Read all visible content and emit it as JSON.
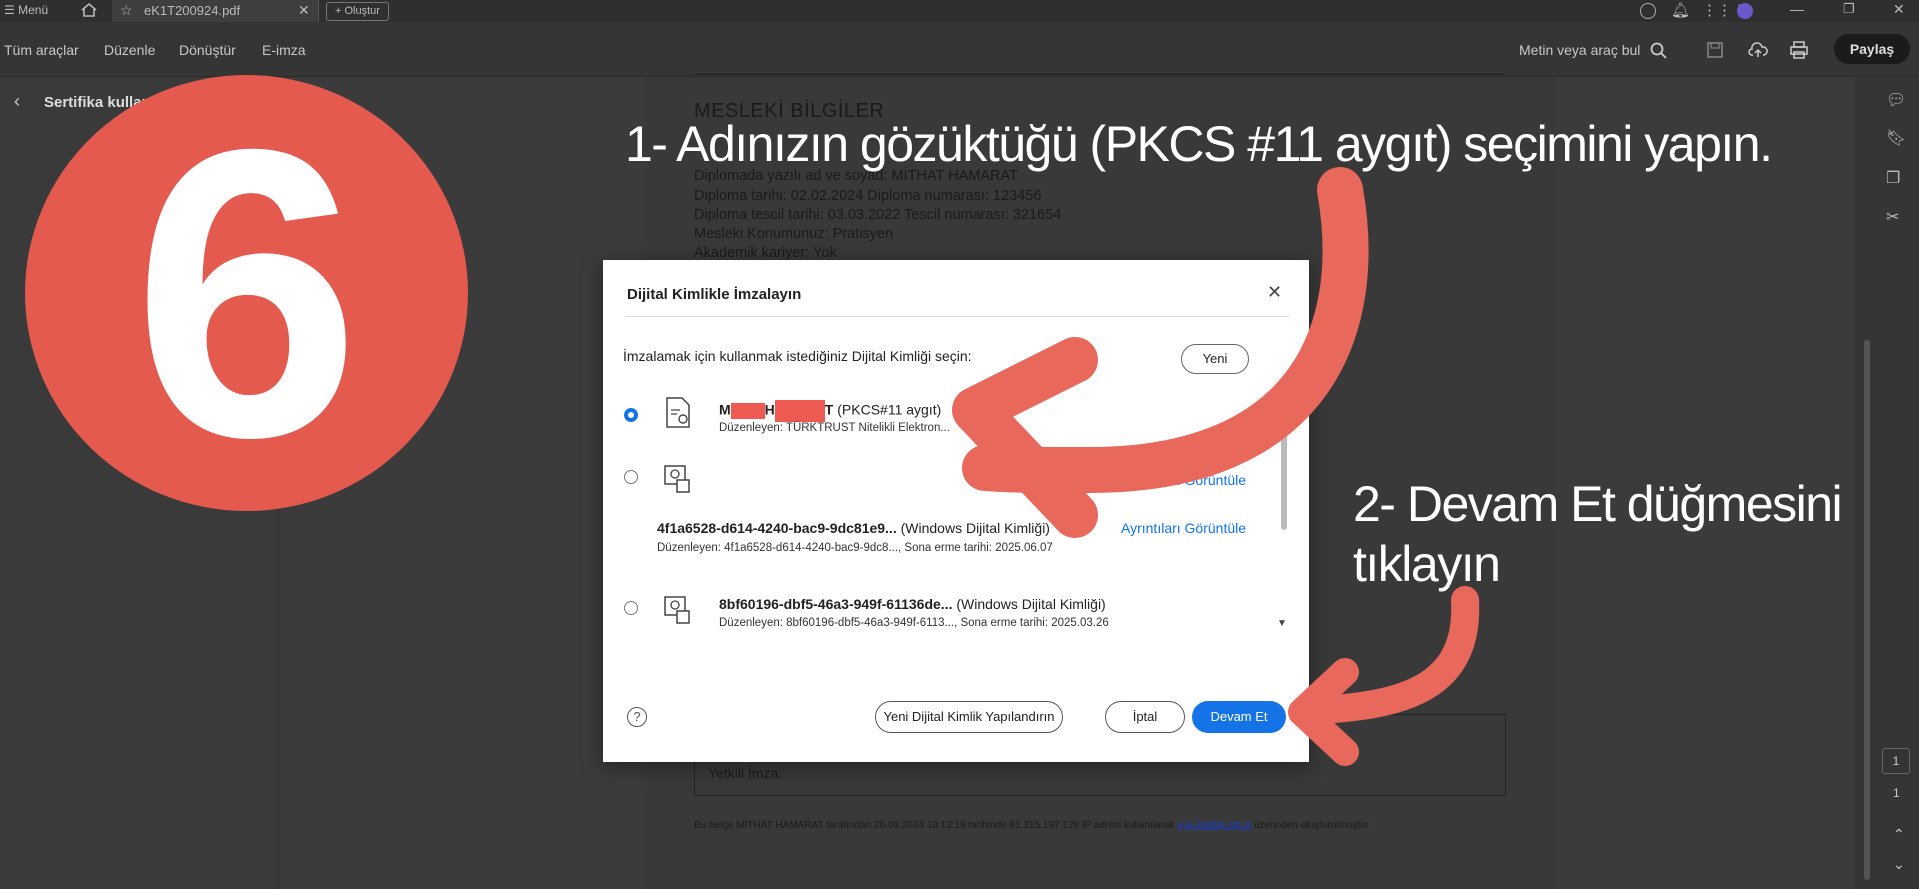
{
  "titlebar": {
    "menu_label": "Menü",
    "tab_label": "eK1T200924.pdf",
    "create_label": "Oluştur"
  },
  "toolbar": {
    "items": [
      "Tüm araçlar",
      "Düzenle",
      "Dönüştür",
      "E-imza"
    ],
    "search_label": "Metin veya araç bul",
    "share_label": "Paylaş"
  },
  "leftpanel": {
    "title": "Sertifika kullan"
  },
  "document": {
    "heading": "MESLEKİ BİLGİLER",
    "lines": [
      "Diplomada yazılı ad ve soyad: MİTHAT HAMARAT",
      "Diploma tarihi: 02.02.2024    Diploma numarası: 123456",
      "Diploma tescil tarihi: 03.03.2022    Tescil numarası: 321654",
      "Mesleki Konumunuz: Pratisyen",
      "Akademik kariyer: Yok"
    ],
    "sign_label": "Yetkili İmza:",
    "footer_before_link": "Bu belge MİTHAT HAMARAT tarafından 20.09.2024 10:13:19 tarihinde 81.215.197.129 IP adresi kullanılarak ",
    "footer_link": "uye.istabip.org.tr",
    "footer_after_link": " üzerinden oluşturulmuştur."
  },
  "rightrail": {
    "page_current": "1",
    "page_total": "1"
  },
  "badge": {
    "number": "6",
    "color": "#e45a4e"
  },
  "dialog": {
    "title": "Dijital Kimlikle İmzalayın",
    "prompt": "İmzalamak için kullanmak istediğiniz Dijital Kimliği seçin:",
    "new_button": "Yeni",
    "certs": [
      {
        "name_start": "M",
        "name_mid": "H",
        "name_end": "T",
        "type": "(PKCS#11 aygıt)",
        "issuer": "Düzenleyen: TÜRKTRUST Nitelikli Elektron...",
        "selected": true
      },
      {
        "name": "4f1a6528-d614-4240-bac9-9dc81e9...",
        "type": "(Windows Dijital Kimliği)",
        "issuer": "Düzenleyen: 4f1a6528-d614-4240-bac9-9dc8..., Sona erme tarihi: 2025.06.07",
        "detail_link": "Ayrıntıları Görüntüle",
        "selected": false
      },
      {
        "name": "8bf60196-dbf5-46a3-949f-61136de...",
        "type": "(Windows Dijital Kimliği)",
        "issuer": "Düzenleyen: 8bf60196-dbf5-46a3-949f-6113..., Sona erme tarihi: 2025.03.26",
        "selected": false
      }
    ],
    "detail_link_top": "Ayrıntıları Görüntüle",
    "help": "?",
    "configure_button": "Yeni Dijital Kimlik Yapılandırın",
    "cancel_button": "İptal",
    "continue_button": "Devam Et",
    "accent_color": "#1473e6"
  },
  "annotations": {
    "step1": "1- Adınızın gözüktüğü (PKCS #11 aygıt) seçimini yapın.",
    "step2_line1": "2- Devam Et düğmesini",
    "step2_line2": "tıklayın",
    "arrow_color": "#e8685c"
  },
  "icons": [
    "home-icon",
    "star-icon",
    "close-icon",
    "plus-icon",
    "help-icon",
    "bell-icon",
    "apps-icon",
    "avatar",
    "search-icon",
    "save-icon",
    "upload-icon",
    "print-icon",
    "back-icon",
    "certificate-icon",
    "comment-icon",
    "bookmark-icon",
    "pages-icon",
    "tools-icon"
  ]
}
